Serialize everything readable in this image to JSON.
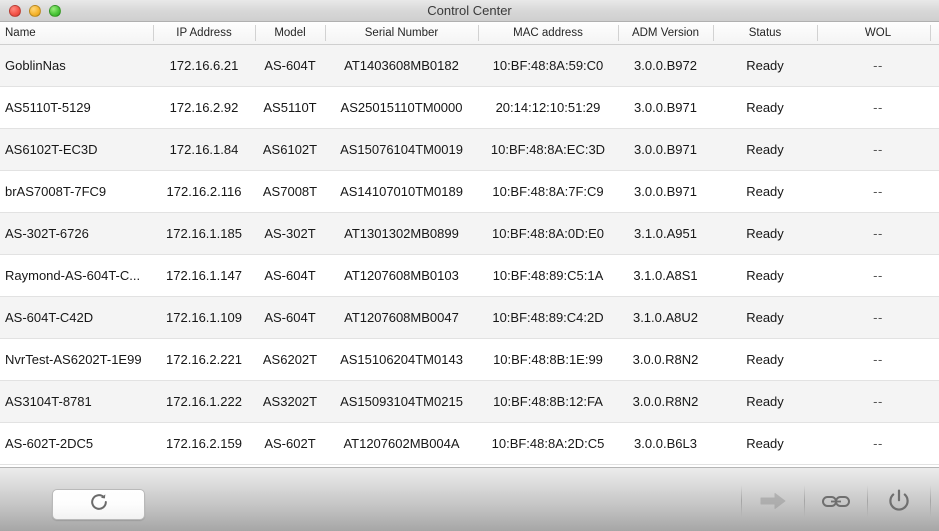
{
  "window": {
    "title": "Control Center",
    "traffic_lights": [
      "close-button",
      "minimize-button",
      "zoom-button"
    ]
  },
  "table": {
    "columns": [
      {
        "key": "name",
        "label": "Name"
      },
      {
        "key": "ip",
        "label": "IP Address"
      },
      {
        "key": "model",
        "label": "Model"
      },
      {
        "key": "serial",
        "label": "Serial Number"
      },
      {
        "key": "mac",
        "label": "MAC address"
      },
      {
        "key": "adm",
        "label": "ADM Version"
      },
      {
        "key": "status",
        "label": "Status"
      },
      {
        "key": "wol",
        "label": "WOL"
      }
    ],
    "rows": [
      {
        "name": "GoblinNas",
        "ip": "172.16.6.21",
        "model": "AS-604T",
        "serial": "AT1403608MB0182",
        "mac": "10:BF:48:8A:59:C0",
        "adm": "3.0.0.B972",
        "status": "Ready",
        "wol": "--"
      },
      {
        "name": "AS5110T-5129",
        "ip": "172.16.2.92",
        "model": "AS5110T",
        "serial": "AS25015110TM0000",
        "mac": "20:14:12:10:51:29",
        "adm": "3.0.0.B971",
        "status": "Ready",
        "wol": "--"
      },
      {
        "name": "AS6102T-EC3D",
        "ip": "172.16.1.84",
        "model": "AS6102T",
        "serial": "AS15076104TM0019",
        "mac": "10:BF:48:8A:EC:3D",
        "adm": "3.0.0.B971",
        "status": "Ready",
        "wol": "--"
      },
      {
        "name": "brAS7008T-7FC9",
        "ip": "172.16.2.116",
        "model": "AS7008T",
        "serial": "AS14107010TM0189",
        "mac": "10:BF:48:8A:7F:C9",
        "adm": "3.0.0.B971",
        "status": "Ready",
        "wol": "--"
      },
      {
        "name": "AS-302T-6726",
        "ip": "172.16.1.185",
        "model": "AS-302T",
        "serial": "AT1301302MB0899",
        "mac": "10:BF:48:8A:0D:E0",
        "adm": "3.1.0.A951",
        "status": "Ready",
        "wol": "--"
      },
      {
        "name": "Raymond-AS-604T-C...",
        "ip": "172.16.1.147",
        "model": "AS-604T",
        "serial": "AT1207608MB0103",
        "mac": "10:BF:48:89:C5:1A",
        "adm": "3.1.0.A8S1",
        "status": "Ready",
        "wol": "--"
      },
      {
        "name": "AS-604T-C42D",
        "ip": "172.16.1.109",
        "model": "AS-604T",
        "serial": "AT1207608MB0047",
        "mac": "10:BF:48:89:C4:2D",
        "adm": "3.1.0.A8U2",
        "status": "Ready",
        "wol": "--"
      },
      {
        "name": "NvrTest-AS6202T-1E99",
        "ip": "172.16.2.221",
        "model": "AS6202T",
        "serial": "AS15106204TM0143",
        "mac": "10:BF:48:8B:1E:99",
        "adm": "3.0.0.R8N2",
        "status": "Ready",
        "wol": "--"
      },
      {
        "name": "AS3104T-8781",
        "ip": "172.16.1.222",
        "model": "AS3202T",
        "serial": "AS15093104TM0215",
        "mac": "10:BF:48:8B:12:FA",
        "adm": "3.0.0.R8N2",
        "status": "Ready",
        "wol": "--"
      },
      {
        "name": "AS-602T-2DC5",
        "ip": "172.16.2.159",
        "model": "AS-602T",
        "serial": "AT1207602MB004A",
        "mac": "10:BF:48:8A:2D:C5",
        "adm": "3.0.0.B6L3",
        "status": "Ready",
        "wol": "--"
      }
    ]
  },
  "toolbar": {
    "refresh_icon": "refresh-icon",
    "actions": [
      {
        "icon": "arrow-right-icon",
        "name": "connect-button",
        "disabled": true
      },
      {
        "icon": "link-icon",
        "name": "link-button",
        "disabled": false
      },
      {
        "icon": "power-icon",
        "name": "power-button",
        "disabled": false
      }
    ]
  },
  "colors": {
    "row_alt": "#f4f4f4",
    "row_base": "#ffffff",
    "text": "#171717",
    "divider": "#e2e2e2",
    "titlebar_text": "#3a3a3a"
  }
}
